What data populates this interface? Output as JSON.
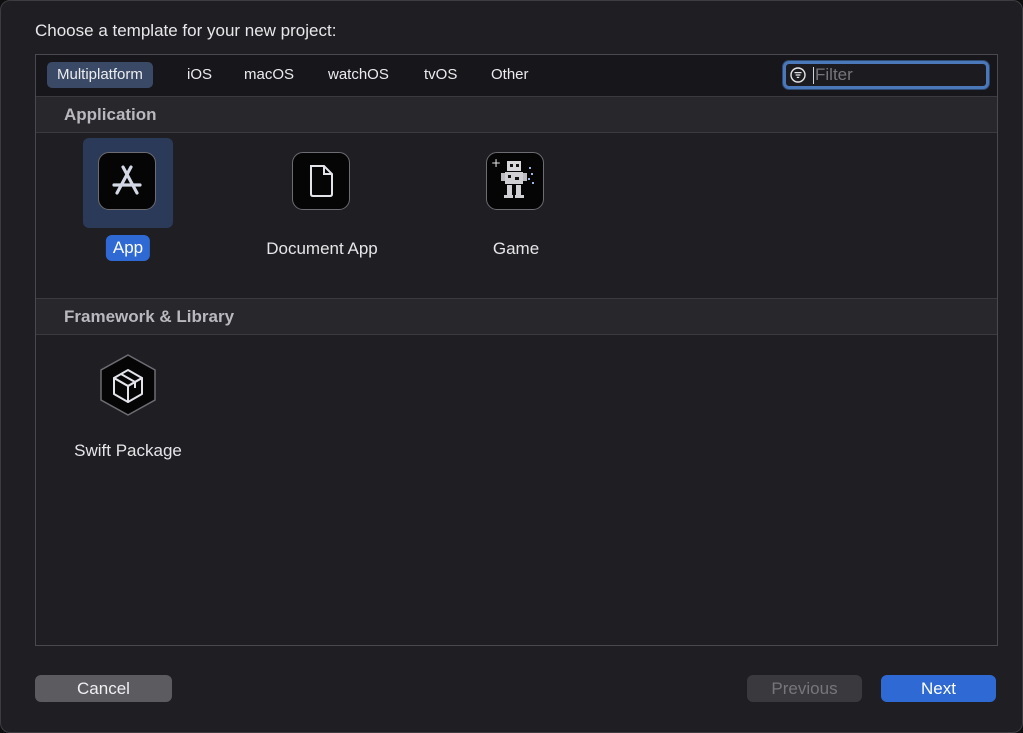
{
  "dialog": {
    "prompt": "Choose a template for your new project:"
  },
  "tabs": [
    {
      "label": "Multiplatform",
      "selected": true
    },
    {
      "label": "iOS",
      "selected": false
    },
    {
      "label": "macOS",
      "selected": false
    },
    {
      "label": "watchOS",
      "selected": false
    },
    {
      "label": "tvOS",
      "selected": false
    },
    {
      "label": "Other",
      "selected": false
    }
  ],
  "filter": {
    "placeholder": "Filter",
    "value": "",
    "icon": "filter-icon"
  },
  "sections": [
    {
      "title": "Application",
      "templates": [
        {
          "label": "App",
          "icon": "app-store-icon",
          "selected": true
        },
        {
          "label": "Document App",
          "icon": "document-icon",
          "selected": false
        },
        {
          "label": "Game",
          "icon": "game-robot-icon",
          "selected": false
        }
      ]
    },
    {
      "title": "Framework & Library",
      "templates": [
        {
          "label": "Swift Package",
          "icon": "package-icon",
          "selected": false
        }
      ]
    }
  ],
  "buttons": {
    "cancel": "Cancel",
    "previous": "Previous",
    "next": "Next"
  },
  "colors": {
    "accent": "#2f6ad4",
    "selected_tab": "#3a4a66",
    "window_bg": "#1f1e23"
  }
}
